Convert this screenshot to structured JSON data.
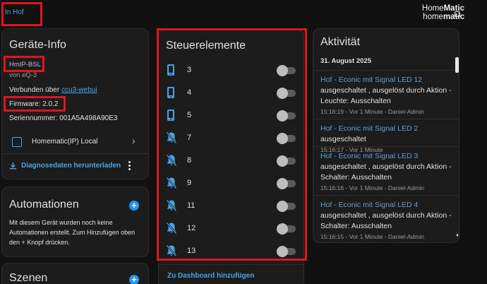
{
  "header": {
    "breadcrumb": "In Hof",
    "logo_line1_a": "Home",
    "logo_line1_b": "Matic",
    "logo_line2_a": "home",
    "logo_line2_b": "matic"
  },
  "device_info": {
    "title": "Geräte-Info",
    "model": "HmIP-BSL",
    "manufacturer": "von eQ-3",
    "connected_prefix": "Verbunden über ",
    "connected_link": "ccu3-webui",
    "firmware": "Firmware: 2.0.2",
    "serial": "Seriennummer: 001A5A498A90E3",
    "integration": "Homematic(IP) Local",
    "download_label": "Diagnosedaten herunterladen"
  },
  "automations": {
    "title": "Automationen",
    "text": "Mit diesem Gerät wurden noch keine Automationen erstellt. Zum Hinzufügen oben den + Knopf drücken."
  },
  "scenes": {
    "title": "Szenen"
  },
  "controls": {
    "title": "Steuerelemente",
    "items": [
      {
        "label": "3",
        "icon": "phone-icon"
      },
      {
        "label": "4",
        "icon": "phone-icon"
      },
      {
        "label": "5",
        "icon": "phone-icon"
      },
      {
        "label": "7",
        "icon": "bell-off-icon"
      },
      {
        "label": "8",
        "icon": "bell-off-icon"
      },
      {
        "label": "9",
        "icon": "bell-off-icon"
      },
      {
        "label": "11",
        "icon": "bell-off-icon"
      },
      {
        "label": "12",
        "icon": "bell-off-icon"
      },
      {
        "label": "13",
        "icon": "bell-off-icon"
      }
    ],
    "add_dashboard": "Zu Dashboard hinzufügen"
  },
  "activity": {
    "title": "Aktivität",
    "date": "31. August 2025",
    "items": [
      {
        "device": "Hof - Econic mit Signal LED 12",
        "text": " ausgeschaltet , ausgelöst durch Aktion - Leuchte: Ausschalten",
        "meta": "15:16:19 - Vor 1 Minute - Daniel-Admin"
      },
      {
        "device": "Hof - Econic mit Signal LED 2",
        "text": " ausgeschaltet",
        "meta": "15:16:17 - Vor 1 Minute"
      },
      {
        "device": "Hof - Econic mit Signal LED 3",
        "text": " ausgeschaltet , ausgelöst durch Aktion - Schalter: Ausschalten",
        "meta": "15:16:16 - Vor 1 Minute - Daniel-Admin"
      },
      {
        "device": "Hof - Econic mit Signal LED 4",
        "text": " ausgeschaltet , ausgelöst durch Aktion - Schalter: Ausschalten",
        "meta": "15:16:15 - Vor 1 Minute - Daniel-Admin"
      }
    ]
  },
  "colors": {
    "accent": "#4aa3e6",
    "highlight": "#e0141e",
    "background": "#111111",
    "card": "#1c1c1c"
  }
}
